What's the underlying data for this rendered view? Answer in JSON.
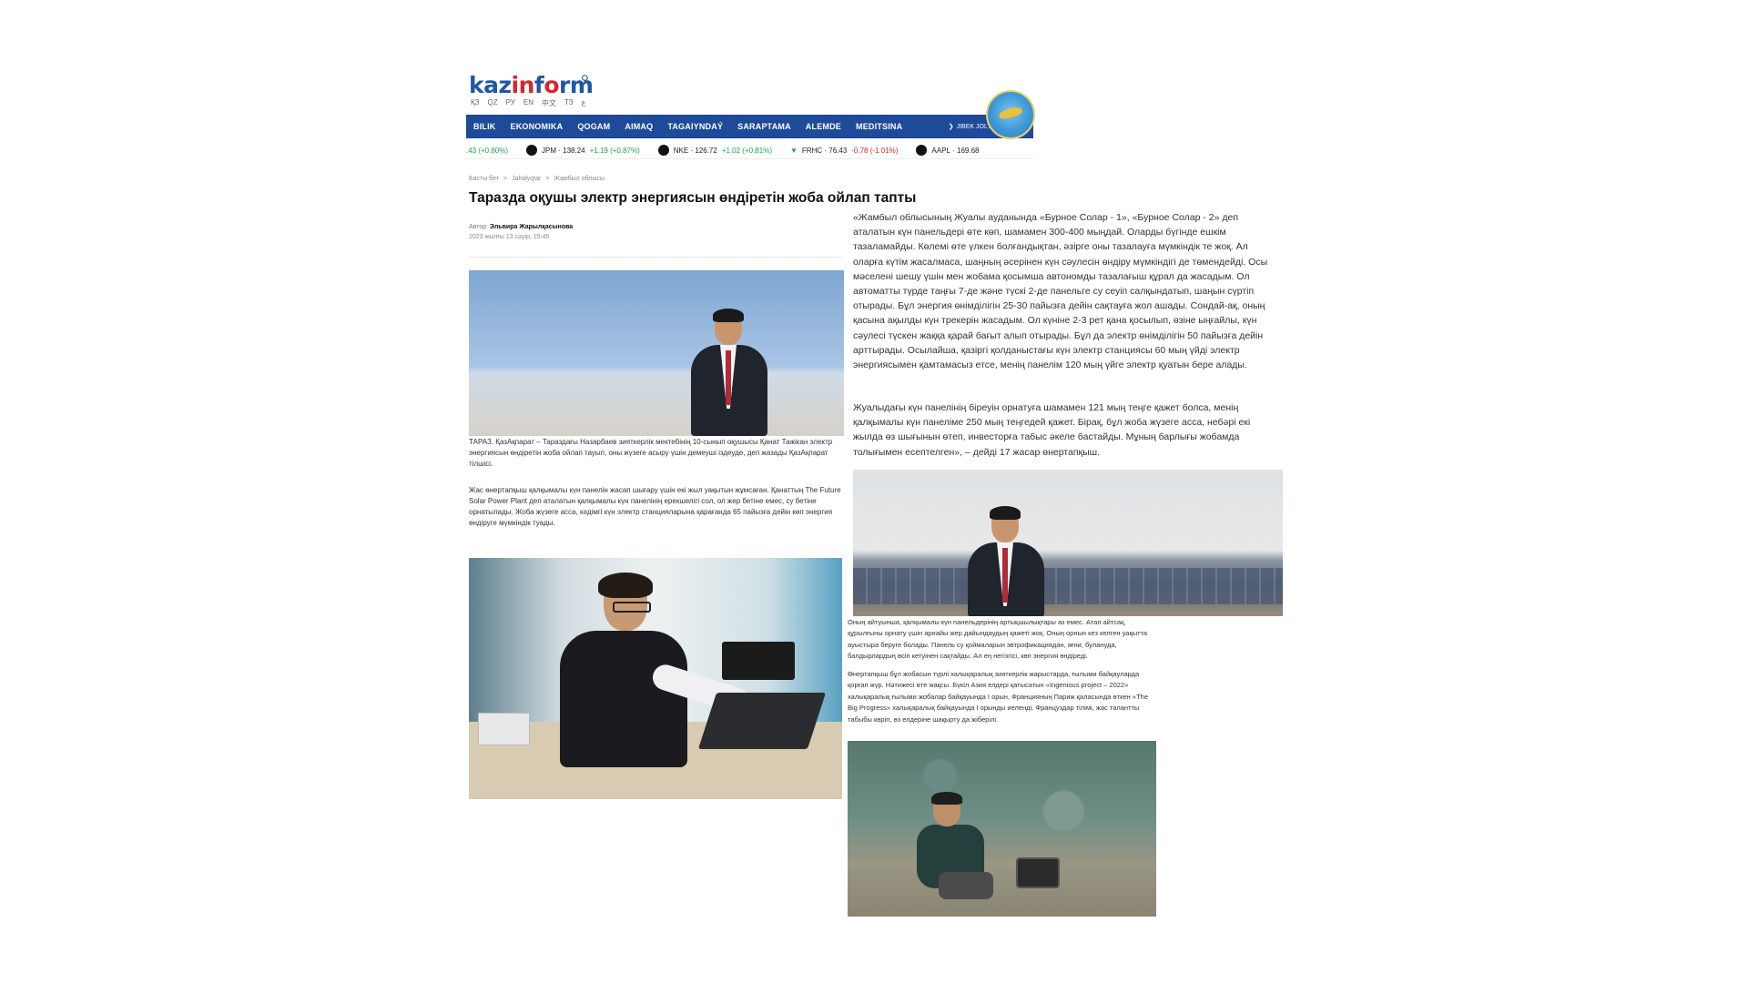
{
  "header": {
    "logo_part1": "kaz",
    "logo_part2": "in",
    "logo_part3": "f",
    "logo_part4": "rm",
    "languages": [
      "ҚЗ",
      "QZ",
      "РУ",
      "EN",
      "中文",
      "ТЗ",
      "ع"
    ],
    "nav": [
      "BILIK",
      "EKONOMIKA",
      "QOGAM",
      "AIMAQ",
      "TAGAIYNDAÝ",
      "SARAPTAMA",
      "ALEMDE",
      "MEDITSINA"
    ],
    "brand": "JIBEK JOLY",
    "ticker_first": ".43 (+0.80%)",
    "ticker": [
      {
        "symbol": "JPM",
        "price": "· 138.24",
        "change": "+1.19 (+0.87%)",
        "dir": "up"
      },
      {
        "symbol": "NKE",
        "price": "· 126.72",
        "change": "+1.02 (+0.81%)",
        "dir": "up"
      },
      {
        "symbol": "FRHC",
        "price": "· 76.43",
        "change": "-0.78 (-1.01%)",
        "dir": "down"
      },
      {
        "symbol": "AAPL",
        "price": "· 169.68",
        "change": "",
        "dir": "up"
      }
    ]
  },
  "breadcrumbs": [
    "Басты бет",
    ">",
    "Jahalyqtar",
    ">",
    "Жамбыл облысы"
  ],
  "article": {
    "headline": "Таразда оқушы электр энергиясын өндіретін жоба ойлап тапты",
    "author_label": "Автор:",
    "author": "Эльвира Жарылқасынова",
    "date": "2023 жылғы 13 сәуір, 15:45",
    "caption1": "ТАРАЗ. ҚазАқпарат – Тараздағы Назарбаев зияткерлік мектебінің 10-сынып оқушысы Қанат Тажікан электр энергиясын өндіретін жоба ойлап тауып, оны жүзеге асыру үшін демеуші іздеуде, деп жазады ҚазАқпарат тілшісі.",
    "para1": "Жас өнертапқыш қалқымалы күн панелін жасап шығару үшін екі жыл уақытын жұмсаған. Қанаттың The Future Solar Power Plant деп аталатын қалқымалы күн панелінің ерекшелігі сол, ол жер бетіне емес, су бетіне орнатылады. Жоба жүзеге асса, кәдімгі күн электр станцияларына қарағанда 65 пайызға дейін көп энергия өндіруге мүмкіндік туады.",
    "quote": "«Жамбыл облысының Жуалы ауданында «Бурное Солар - 1», «Бурное Солар - 2» деп аталатын күн панельдері өте көп, шамамен 300-400 мыңдай. Оларды бүгінде ешкім тазаламайды. Көлемі өте үлкен болғандықтан, әзірге оны тазалауға мүмкіндік те жоқ. Ал оларға күтім жасалмаса, шаңның әсерінен күн сәулесін өндіру мүмкіндігі де төмендейді. Осы мәселені шешу үшін мен жобама қосымша автономды тазалағыш құрал да жасадым. Ол автоматты түрде таңғы 7-де және түскі 2-де панельге су сеуіп салқындатып, шаңын сүртіп отырады. Бұл энергия өнімділігін 25-30 пайызға дейін сақтауға жол ашады. Сондай-ақ, оның қасына ақылды күн трекерін жасадым. Ол күніне 2-3 рет қана қосылып, өзіне ыңғайлы, күн сәулесі түскен жаққа қарай бағыт алып отырады. Бұл да электр өнімділігін 50 пайызға дейін арттырады. Осылайша, қазіргі қолданыстағы күн электр станциясы 60 мың үйді электр энергиясымен қамтамасыз етсе, менің панелім 120 мың үйге электр қуатын бере алады.",
    "para2": "Жуалыдағы күн панелінің біреуін орнатуға шамамен 121 мың теңге қажет болса, менің қалқымалы күн панеліме 250 мың теңгедей қажет. Бірақ, бұл жоба жүзеге асса, небәрі екі жылда өз шығынын өтеп, инвесторға табыс әкеле бастайды. Мұның барлығы жобамда толығымен есептелген», – дейді 17 жасар өнертапқыш.",
    "caption2": "Оның айтуынша, қалқымалы күн панельдерінің артықшылықтары аз емес. Атап айтсақ, құрылғыны орнату үшін арнайы жер дайындаудың қажеті жоқ. Оның орнын кез келген уақытта ауыстыра беруге болады. Панель су қоймаларын эвтрофикациядан, яғни, булануда, балдырлардың өсіп кетуінен сақтайды. Ал ең негізгісі, көп энергия өндіреді.",
    "caption3": "Өнертапқыш бұл жобасын түрлі халықаралық зияткерлік жарыстарда, ғылыми байқауларда қорғап жүр. Нәтижесі өте жақсы. Бүкіл Азия елдері қатысатын «Ingenious project – 2022» халықаралық ғылыми жобалар байқауында I орын, Францияның Париж қаласында өткен «The Big Progress» халықаралық байқауында I орынды иеленді. Француздар тілімі, жас талантты табыбы көріп, өз елдеріне шақырту да жіберілі."
  },
  "colors": {
    "nav_bg": "#1e4a9a",
    "logo_blue": "#1f57a4",
    "logo_red": "#d6272c",
    "ticker_up": "#1aa355",
    "ticker_down": "#d6272c"
  }
}
